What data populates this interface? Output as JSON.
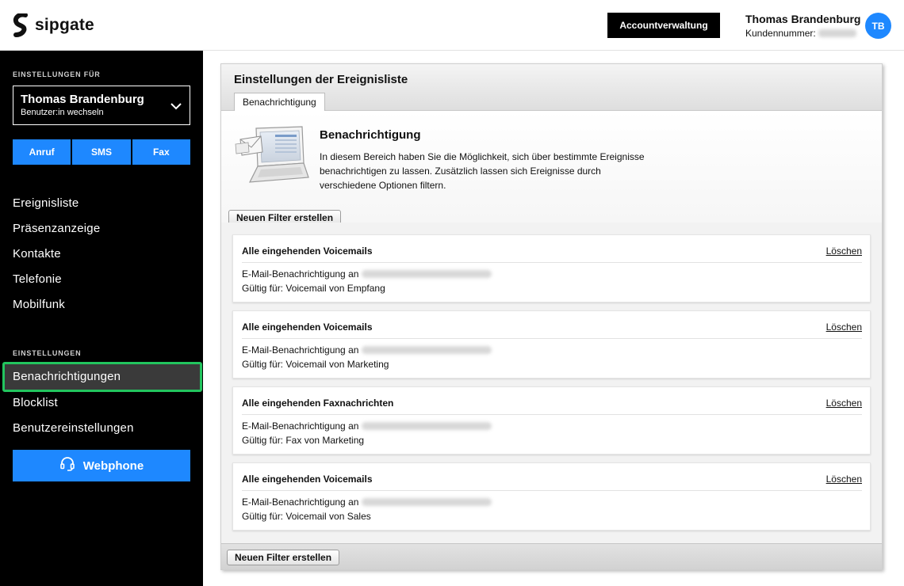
{
  "header": {
    "logo_text": "sipgate",
    "account_button": "Accountverwaltung",
    "user_name": "Thomas Brandenburg",
    "customer_label": "Kundennummer:",
    "avatar_initials": "TB"
  },
  "sidebar": {
    "settings_for_label": "EINSTELLUNGEN FÜR",
    "selected_user": "Thomas Brandenburg",
    "switch_user": "Benutzer:in wechseln",
    "quick_actions": [
      "Anruf",
      "SMS",
      "Fax"
    ],
    "nav_items": [
      "Ereignisliste",
      "Präsenzanzeige",
      "Kontakte",
      "Telefonie",
      "Mobilfunk"
    ],
    "settings_label": "EINSTELLUNGEN",
    "settings_items": [
      "Benachrichtigungen",
      "Blocklist",
      "Benutzereinstellungen"
    ],
    "active_item": "Benachrichtigungen",
    "webphone_button": "Webphone"
  },
  "panel": {
    "title": "Einstellungen der Ereignisliste",
    "tab": "Benachrichtigung",
    "intro_title": "Benachrichtigung",
    "intro_text": "In diesem Bereich haben Sie die Möglichkeit, sich über bestimmte Ereignisse benachrichtigen zu lassen. Zusätzlich lassen sich Ereignisse durch verschiedene Optionen filtern.",
    "new_filter_button": "Neuen Filter erstellen",
    "delete_label": "Löschen",
    "filters": [
      {
        "title": "Alle eingehenden Voicemails",
        "line1": "E-Mail-Benachrichtigung an",
        "line2": "Gültig für: Voicemail von Empfang"
      },
      {
        "title": "Alle eingehenden Voicemails",
        "line1": "E-Mail-Benachrichtigung an",
        "line2": "Gültig für: Voicemail von Marketing"
      },
      {
        "title": "Alle eingehenden Faxnachrichten",
        "line1": "E-Mail-Benachrichtigung an",
        "line2": "Gültig für: Fax von Marketing"
      },
      {
        "title": "Alle eingehenden Voicemails",
        "line1": "E-Mail-Benachrichtigung an",
        "line2": "Gültig für: Voicemail von Sales"
      }
    ]
  },
  "colors": {
    "accent_blue": "#1e88ff",
    "active_outline": "#22c55e",
    "sidebar_bg": "#000000"
  }
}
